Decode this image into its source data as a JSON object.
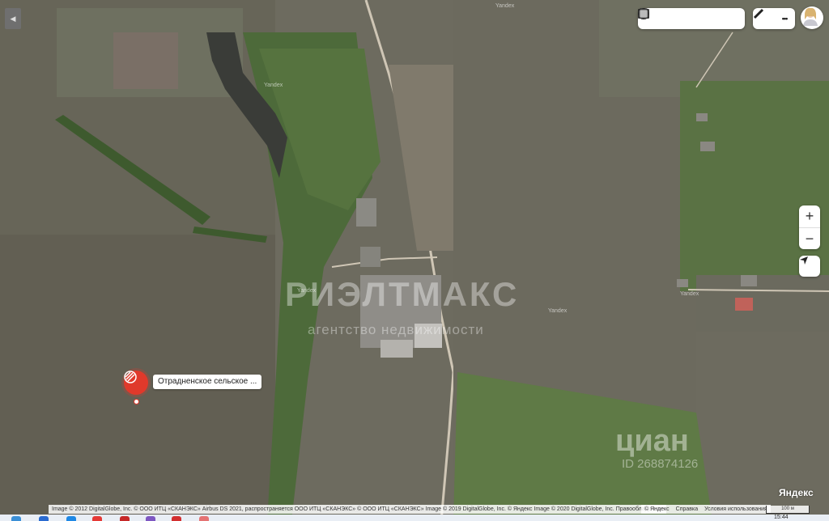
{
  "map": {
    "marker_label": "Отрадненское сельское ...",
    "road_labels": [
      "Yandex",
      "Yandex",
      "Yandex",
      "Yandex",
      "Yandex"
    ],
    "watermark": "РИЭЛТМАКС",
    "watermark_sub": "агентство недвижимости",
    "cian_logo": "циан",
    "cian_id": "ID 268874126",
    "copyright": "Image © 2012 DigitalGlobe, Inc. © ООО ИТЦ «СКАНЭКС» Airbus DS 2021, распространяется ООО ИТЦ «СКАНЭКС» © ООО ИТЦ «СКАНЭКС» Image © 2019 DigitalGlobe, Inc. © Яндекс Image © 2020 DigitalGlobe, Inc.   Правообладатели",
    "links": [
      "© Яндекс",
      "Справка",
      "Условия использования"
    ],
    "scale": "100 м",
    "brand": "Яндекс",
    "zoom_in": "+",
    "zoom_out": "−",
    "more": "•••"
  },
  "toolbar": {
    "icons": [
      "layers-icon",
      "panorama-icon",
      "camera-icon",
      "transport-icon",
      "traffic-icon"
    ]
  },
  "taskbar": {
    "clock": "15:44"
  },
  "colors": {
    "marker": "#e0392b",
    "field": "#6b6a5e"
  }
}
